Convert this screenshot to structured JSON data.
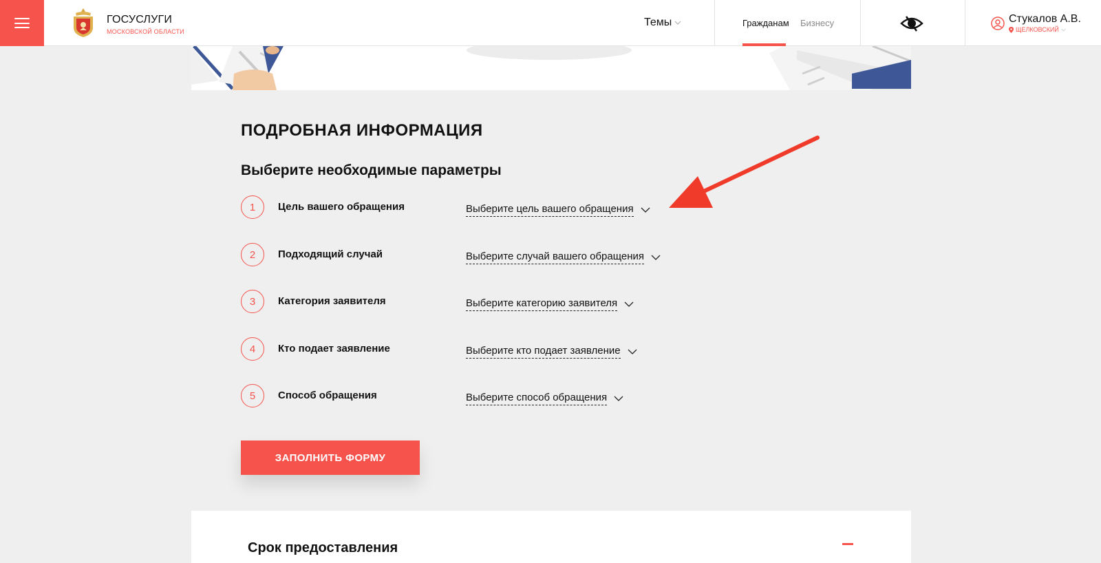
{
  "header": {
    "brand_title": "ГОСУСЛУГИ",
    "brand_subtitle": "МОСКОВСКОЙ ОБЛАСТИ",
    "themes_label": "Темы",
    "tabs": [
      {
        "label": "Гражданам",
        "active": true
      },
      {
        "label": "Бизнесу",
        "active": false
      }
    ],
    "user_name": "Стукалов А.В.",
    "user_city": "ЩЕЛКОВСКИЙ"
  },
  "main": {
    "title": "ПОДРОБНАЯ ИНФОРМАЦИЯ",
    "subtitle": "Выберите необходимые параметры",
    "params": [
      {
        "number": "1",
        "label": "Цель вашего обращения",
        "select": "Выберите цель вашего обращения"
      },
      {
        "number": "2",
        "label": "Подходящий случай",
        "select": "Выберите случай вашего обращения"
      },
      {
        "number": "3",
        "label": "Категория заявителя",
        "select": "Выберите категорию заявителя"
      },
      {
        "number": "4",
        "label": "Кто подает заявление",
        "select": "Выберите кто подает заявление"
      },
      {
        "number": "5",
        "label": "Способ обращения",
        "select": "Выберите способ обращения"
      }
    ],
    "submit_label": "ЗАПОЛНИТЬ ФОРМУ"
  },
  "accordion": {
    "title": "Срок предоставления"
  },
  "colors": {
    "accent": "#f5534b",
    "background": "#efefef",
    "annotation": "#f03a2a"
  },
  "icons": [
    "menu-icon",
    "coat-of-arms-logo",
    "chevron-down-icon",
    "eye-icon",
    "user-icon",
    "location-pin-icon",
    "minus-icon",
    "annotation-arrow"
  ]
}
